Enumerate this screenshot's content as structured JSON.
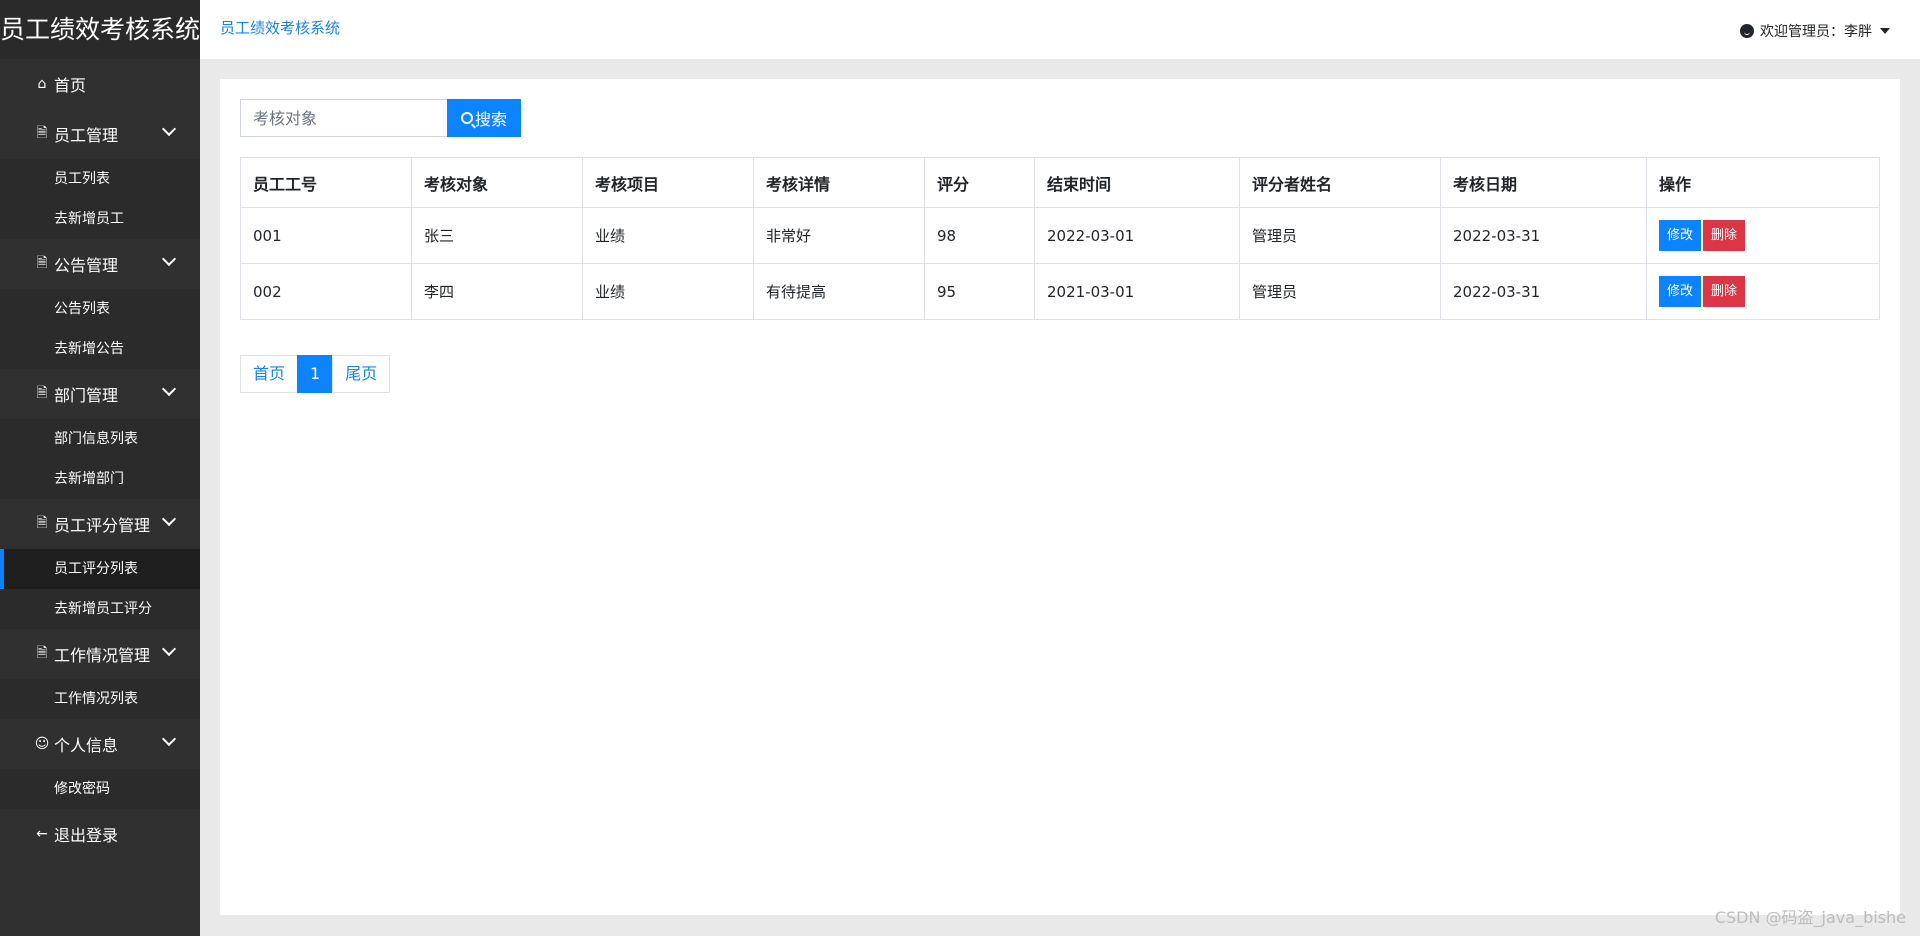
{
  "app": {
    "title": "员工绩效考核系统"
  },
  "header": {
    "breadcrumb": "员工绩效考核系统",
    "welcome": "欢迎管理员：李胖"
  },
  "sidebar": {
    "home": "首页",
    "groups": [
      {
        "label": "员工管理",
        "items": [
          "员工列表",
          "去新增员工"
        ]
      },
      {
        "label": "公告管理",
        "items": [
          "公告列表",
          "去新增公告"
        ]
      },
      {
        "label": "部门管理",
        "items": [
          "部门信息列表",
          "去新增部门"
        ]
      },
      {
        "label": "员工评分管理",
        "items": [
          "员工评分列表",
          "去新增员工评分"
        ]
      },
      {
        "label": "工作情况管理",
        "items": [
          "工作情况列表"
        ]
      },
      {
        "label": "个人信息",
        "items": [
          "修改密码"
        ]
      }
    ],
    "logout": "退出登录",
    "active_item": "员工评分列表"
  },
  "search": {
    "placeholder": "考核对象",
    "button": "搜索"
  },
  "table": {
    "headers": [
      "员工工号",
      "考核对象",
      "考核项目",
      "考核详情",
      "评分",
      "结束时间",
      "评分者姓名",
      "考核日期",
      "操作"
    ],
    "rows": [
      [
        "001",
        "张三",
        "业绩",
        "非常好",
        "98",
        "2022-03-01",
        "管理员",
        "2022-03-31"
      ],
      [
        "002",
        "李四",
        "业绩",
        "有待提高",
        "95",
        "2021-03-01",
        "管理员",
        "2022-03-31"
      ]
    ],
    "edit_label": "修改",
    "delete_label": "删除"
  },
  "pagination": {
    "first": "首页",
    "current": "1",
    "last": "尾页"
  },
  "watermark": "CSDN @码盗_java_bishe",
  "colors": {
    "primary": "#0d84ff",
    "danger": "#dc3545",
    "sidebar": "#303030"
  }
}
